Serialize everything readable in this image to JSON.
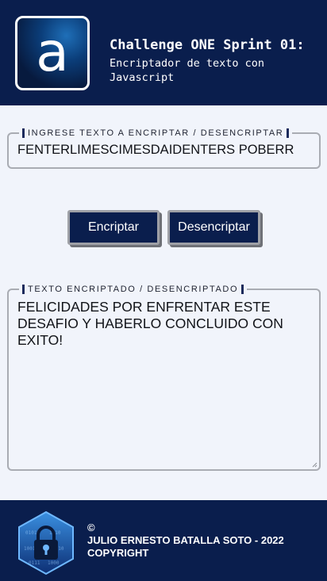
{
  "header": {
    "logo_letter": "a",
    "title": "Challenge ONE Sprint 01:",
    "subtitle": "Encriptador de texto con Javascript"
  },
  "input_section": {
    "legend": "INGRESE TEXTO A ENCRIPTAR / DESENCRIPTAR",
    "value": "FENTERLIMESCIMESDAIDENTERS POBERR"
  },
  "actions": {
    "encrypt_label": "Encriptar",
    "decrypt_label": "Desencriptar"
  },
  "output_section": {
    "legend": "TEXTO ENCRIPTADO / DESENCRIPTADO",
    "value": "FELICIDADES POR ENFRENTAR ESTE DESAFIO Y HABERLO CONCLUIDO CON EXITO!"
  },
  "footer": {
    "copyright_symbol": "©",
    "author_line": "JULIO ERNESTO BATALLA SOTO - 2022",
    "copyright_word": "COPYRIGHT",
    "badge_icon": "lock-hexagon-icon"
  },
  "colors": {
    "navy": "#0a1e4d",
    "background": "#f1f4fb",
    "border": "#a9acb3",
    "button_border": "#9ea0a6"
  }
}
